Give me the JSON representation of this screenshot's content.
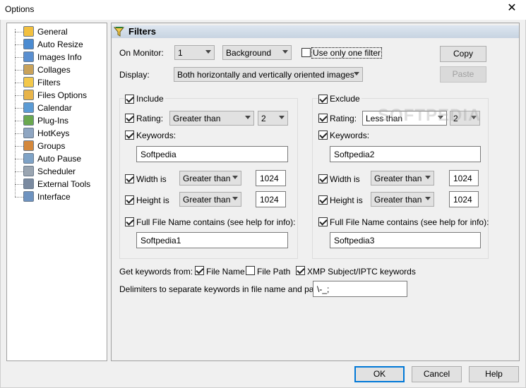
{
  "window": {
    "title": "Options"
  },
  "tree": {
    "items": [
      {
        "label": "General",
        "icon": "pencil-icon"
      },
      {
        "label": "Auto Resize",
        "icon": "resize-icon"
      },
      {
        "label": "Images Info",
        "icon": "info-icon"
      },
      {
        "label": "Collages",
        "icon": "collage-icon"
      },
      {
        "label": "Filters",
        "icon": "filter-icon"
      },
      {
        "label": "Files Options",
        "icon": "files-icon"
      },
      {
        "label": "Calendar",
        "icon": "calendar-icon"
      },
      {
        "label": "Plug-Ins",
        "icon": "plugin-icon"
      },
      {
        "label": "HotKeys",
        "icon": "keyboard-icon"
      },
      {
        "label": "Groups",
        "icon": "groups-icon"
      },
      {
        "label": "Auto Pause",
        "icon": "pause-icon"
      },
      {
        "label": "Scheduler",
        "icon": "clock-icon"
      },
      {
        "label": "External Tools",
        "icon": "wrench-icon"
      },
      {
        "label": "Interface",
        "icon": "window-icon"
      }
    ],
    "selected": "Filters"
  },
  "panel": {
    "title": "Filters",
    "monitor_label": "On Monitor:",
    "monitor_value": "1",
    "layer_value": "Background",
    "use_only_one_label": "Use only one filter",
    "use_only_one_checked": false,
    "copy_label": "Copy",
    "paste_label": "Paste",
    "display_label": "Display:",
    "display_value": "Both horizontally and vertically oriented images"
  },
  "include": {
    "header": "Include",
    "checked": true,
    "rating_label": "Rating:",
    "rating_checked": true,
    "rating_op": "Greater than",
    "rating_value": "2",
    "keywords_label": "Keywords:",
    "keywords_checked": true,
    "keywords_value": "Softpedia",
    "width_label": "Width is",
    "width_checked": true,
    "width_op": "Greater than",
    "width_value": "1024",
    "height_label": "Height is",
    "height_checked": true,
    "height_op": "Greater than",
    "height_value": "1024",
    "filename_label": "Full File Name contains (see help for info):",
    "filename_checked": true,
    "filename_value": "Softpedia1"
  },
  "exclude": {
    "header": "Exclude",
    "checked": true,
    "rating_label": "Rating:",
    "rating_checked": true,
    "rating_op": "Less than",
    "rating_value": "2",
    "keywords_label": "Keywords:",
    "keywords_checked": true,
    "keywords_value": "Softpedia2",
    "width_label": "Width is",
    "width_checked": true,
    "width_op": "Greater than",
    "width_value": "1024",
    "height_label": "Height is",
    "height_checked": true,
    "height_op": "Greater than",
    "height_value": "1024",
    "filename_label": "Full File Name contains (see help for info):",
    "filename_checked": true,
    "filename_value": "Softpedia3"
  },
  "keywords_from": {
    "label": "Get keywords from:",
    "file_name": "File Name",
    "file_name_checked": true,
    "file_path": "File Path",
    "file_path_checked": false,
    "xmp": "XMP Subject/IPTC keywords",
    "xmp_checked": true
  },
  "delimiters": {
    "label": "Delimiters to separate keywords in file name and path:",
    "value": "\\-_;"
  },
  "footer": {
    "ok": "OK",
    "cancel": "Cancel",
    "help": "Help"
  },
  "watermark": "SOFTPEDIA",
  "colors": {
    "accent": "#0078d7",
    "header_bg": "#c7d3e1"
  }
}
